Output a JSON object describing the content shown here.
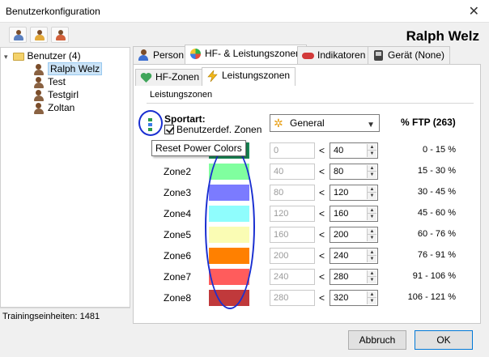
{
  "window": {
    "title": "Benutzerkonfiguration",
    "close_glyph": "✕"
  },
  "toolbar": {
    "icons": [
      "add-user-icon",
      "edit-user-icon",
      "delete-user-icon"
    ]
  },
  "header": {
    "user_name": "Ralph Welz"
  },
  "tree": {
    "root_label": "Benutzer (4)",
    "users": [
      "Ralph Welz",
      "Test",
      "Testgirl",
      "Zoltan"
    ],
    "selected": "Ralph Welz"
  },
  "status": {
    "text": "Trainingseinheiten: 1481"
  },
  "tabs": [
    "Person",
    "HF- & Leistungszonen",
    "Indikatoren",
    "Gerät (None)"
  ],
  "active_tab": "HF- & Leistungszonen",
  "subtabs": [
    "HF-Zonen",
    "Leistungszonen"
  ],
  "active_subtab": "Leistungszonen",
  "zones_group": {
    "title": "Leistungszonen",
    "sport_label": "Sportart:",
    "custom_zones_label": "Benutzerdef. Zonen",
    "custom_zones_checked": true,
    "sport_value": "General",
    "ftp_header": "% FTP (263)",
    "reset_tooltip": "Reset Power Colors",
    "zones": [
      {
        "label": "Zone1",
        "color": "#1a8f5a",
        "from": "0",
        "to": "40",
        "range": "0 - 15 %"
      },
      {
        "label": "Zone2",
        "color": "#80ff9f",
        "from": "40",
        "to": "80",
        "range": "15 - 30 %"
      },
      {
        "label": "Zone3",
        "color": "#7b7bff",
        "from": "80",
        "to": "120",
        "range": "30 - 45 %"
      },
      {
        "label": "Zone4",
        "color": "#8ffdfd",
        "from": "120",
        "to": "160",
        "range": "45 - 60 %"
      },
      {
        "label": "Zone5",
        "color": "#fafcb4",
        "from": "160",
        "to": "200",
        "range": "60 - 76 %"
      },
      {
        "label": "Zone6",
        "color": "#ff8000",
        "from": "200",
        "to": "240",
        "range": "76 - 91 %"
      },
      {
        "label": "Zone7",
        "color": "#ff5c5c",
        "from": "240",
        "to": "280",
        "range": "91 - 106 %"
      },
      {
        "label": "Zone8",
        "color": "#c0393b",
        "from": "280",
        "to": "320",
        "range": "106 - 121 %"
      }
    ]
  },
  "buttons": {
    "cancel": "Abbruch",
    "ok": "OK"
  }
}
